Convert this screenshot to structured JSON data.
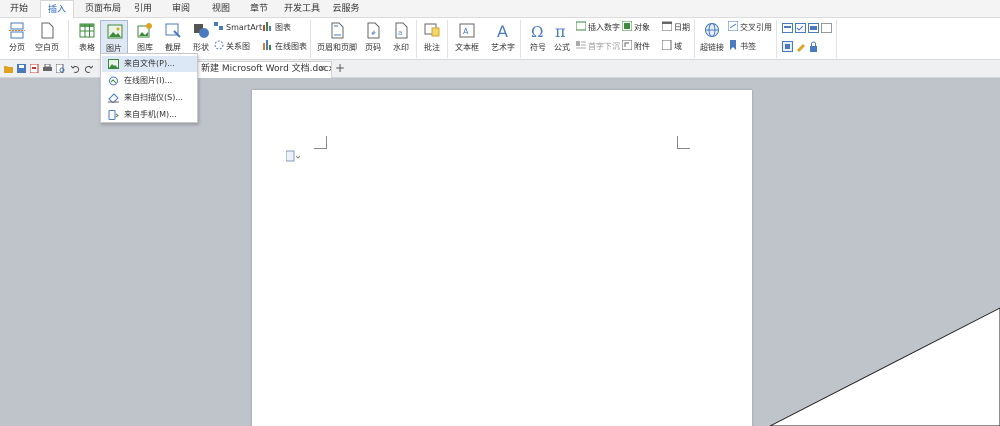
{
  "menu_tabs": [
    "开始",
    "插入",
    "页面布局",
    "引用",
    "审阅",
    "视图",
    "章节",
    "开发工具",
    "云服务"
  ],
  "active_tab": "插入",
  "ribbon": {
    "page_break": "分页",
    "blank_page": "空白页",
    "table": "表格",
    "picture": "图片",
    "gallery": "图库",
    "screenshot": "截屏",
    "shapes": "形状",
    "smartart": "SmartArt",
    "chart": "图表",
    "relationship": "关系图",
    "online_chart": "在线图表",
    "header_footer": "页眉和页脚",
    "page_number": "页码",
    "watermark": "水印",
    "comment": "批注",
    "textbox": "文本框",
    "wordart": "艺术字",
    "symbol": "符号",
    "formula": "公式",
    "insert_number": "插入数字",
    "object": "对象",
    "date": "日期",
    "drop_cap": "首字下沉",
    "attachment": "附件",
    "field": "域",
    "hyperlink": "超链接",
    "cross_ref": "交叉引用",
    "bookmark": "书签"
  },
  "document_tab": {
    "title": "新建 Microsoft Word 文档.docx",
    "close": "×",
    "new": "+"
  },
  "picture_menu": [
    {
      "icon": "image-file-icon",
      "label": "来自文件(P)..."
    },
    {
      "icon": "online-image-icon",
      "label": "在线图片(I)..."
    },
    {
      "icon": "scanner-icon",
      "label": "来自扫描仪(S)..."
    },
    {
      "icon": "phone-icon",
      "label": "来自手机(M)..."
    }
  ],
  "colors": {
    "accent": "#2a6ac0",
    "workspace": "#bfc3ca",
    "menu_hover": "#dde8f6"
  }
}
